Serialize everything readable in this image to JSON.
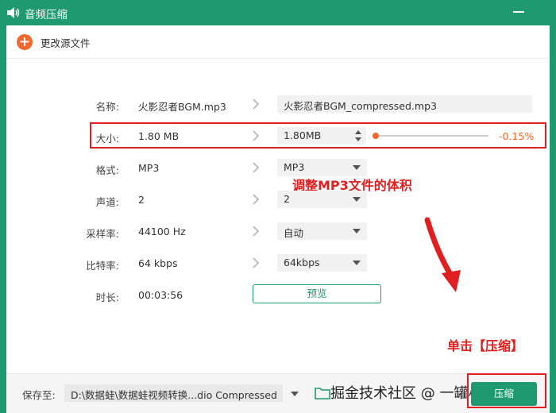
{
  "window": {
    "title": "音频压缩",
    "icon": "speaker-wave-icon"
  },
  "toolbar": {
    "change_source_label": "更改源文件",
    "icon": "plus-circle-icon"
  },
  "fields": {
    "name": {
      "label": "名称:",
      "source": "火影忍者BGM.mp3",
      "output": "火影忍者BGM_compressed.mp3"
    },
    "size": {
      "label": "大小:",
      "source": "1.80 MB",
      "output": "1.80MB",
      "ratio": "-0.15%",
      "slider_value": 0.0
    },
    "format": {
      "label": "格式:",
      "source": "MP3",
      "output": "MP3"
    },
    "channel": {
      "label": "声道:",
      "source": "2",
      "output": "2"
    },
    "sample_rate": {
      "label": "采样率:",
      "source": "44100 Hz",
      "output": "自动"
    },
    "bitrate": {
      "label": "比特率:",
      "source": "64 kbps",
      "output": "64kbps"
    },
    "duration": {
      "label": "时长:",
      "source": "00:03:56"
    }
  },
  "preview_label": "预览",
  "annotations": {
    "adjust": "调整MP3文件的体积",
    "click": "单击【压缩】"
  },
  "footer": {
    "save_label": "保存至:",
    "save_path": "D:\\数据蛙\\数据蛙视频转换...dio Compressed",
    "watermark": "掘金技术社区 @ 一罐小可乐",
    "compress_label": "压缩"
  },
  "colors": {
    "accent": "#1f9a70",
    "orange": "#f0692e",
    "annotation": "#e02020"
  }
}
